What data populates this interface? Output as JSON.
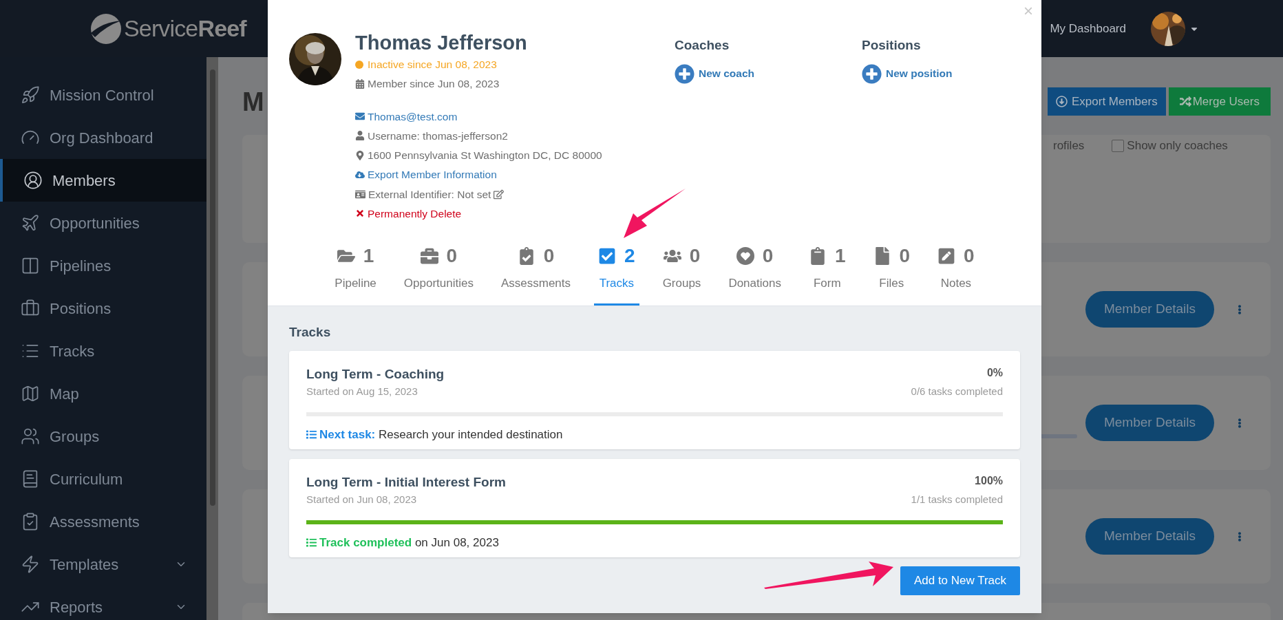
{
  "logo": {
    "text": "Service**Reef**"
  },
  "header": {
    "link": "My Dashboard"
  },
  "sidebar": {
    "items": [
      {
        "label": "Mission Control",
        "selected": false,
        "has_submenu": false
      },
      {
        "label": "Org Dashboard",
        "selected": false,
        "has_submenu": false
      },
      {
        "label": "Members",
        "selected": true,
        "has_submenu": false
      },
      {
        "label": "Opportunities",
        "selected": false,
        "has_submenu": false
      },
      {
        "label": "Pipelines",
        "selected": false,
        "has_submenu": false
      },
      {
        "label": "Positions",
        "selected": false,
        "has_submenu": false
      },
      {
        "label": "Tracks",
        "selected": false,
        "has_submenu": false
      },
      {
        "label": "Map",
        "selected": false,
        "has_submenu": false
      },
      {
        "label": "Groups",
        "selected": false,
        "has_submenu": false
      },
      {
        "label": "Curriculum",
        "selected": false,
        "has_submenu": false
      },
      {
        "label": "Assessments",
        "selected": false,
        "has_submenu": false
      },
      {
        "label": "Templates",
        "selected": false,
        "has_submenu": true
      },
      {
        "label": "Reports",
        "selected": false,
        "has_submenu": true
      }
    ]
  },
  "page": {
    "title": "M",
    "buttons": [
      "Export Members",
      "Merge Users"
    ],
    "filters": [
      {
        "label": "rofiles",
        "kind": "text"
      },
      {
        "label": "Show only coaches",
        "kind": "checkbox",
        "checked": false
      }
    ],
    "member_cards": [
      {
        "button": "Member Details",
        "kind": "plain"
      },
      {
        "button": "Member Details",
        "kind": "with_strip"
      },
      {
        "button": "Member Details",
        "kind": "plain"
      }
    ]
  },
  "modal": {
    "close": "×",
    "member": {
      "name": "Thomas Jefferson",
      "status": "Inactive since Jun 08, 2023",
      "member_since": "Member since Jun 08, 2023",
      "email": "Thomas@test.com",
      "username": "Username: thomas-jefferson2",
      "address": "1600 Pennsylvania St Washington DC, DC 80000",
      "export": "Export Member Information",
      "external_id": "External Identifier: Not set",
      "delete": "Permanently Delete"
    },
    "coaches": {
      "title": "Coaches",
      "action": "New coach"
    },
    "positions": {
      "title": "Positions",
      "action": "New position"
    },
    "tabs": [
      {
        "count": "1",
        "label": "Pipeline",
        "selected": false
      },
      {
        "count": "0",
        "label": "Opportunities",
        "selected": false
      },
      {
        "count": "0",
        "label": "Assessments",
        "selected": false
      },
      {
        "count": "2",
        "label": "Tracks",
        "selected": true
      },
      {
        "count": "0",
        "label": "Groups",
        "selected": false
      },
      {
        "count": "0",
        "label": "Donations",
        "selected": false
      },
      {
        "count": "1",
        "label": "Form",
        "selected": false
      },
      {
        "count": "0",
        "label": "Files",
        "selected": false
      },
      {
        "count": "0",
        "label": "Notes",
        "selected": false
      }
    ],
    "section_title": "Tracks",
    "tracks": [
      {
        "title": "Long Term - Coaching",
        "started": "Started on Aug 15, 2023",
        "percent": "0%",
        "tasks": "0/6 tasks completed",
        "level": 0,
        "kind": "next_task",
        "footer_label": "Next task:",
        "footer_text": "Research your intended destination"
      },
      {
        "title": "Long Term - Initial Interest Form",
        "started": "Started on Jun 08, 2023",
        "percent": "100%",
        "tasks": "1/1 tasks completed",
        "level": 1,
        "kind": "completed",
        "footer_label": "Track completed",
        "footer_text": "on Jun 08, 2023"
      }
    ],
    "add_button": "Add to New Track"
  }
}
